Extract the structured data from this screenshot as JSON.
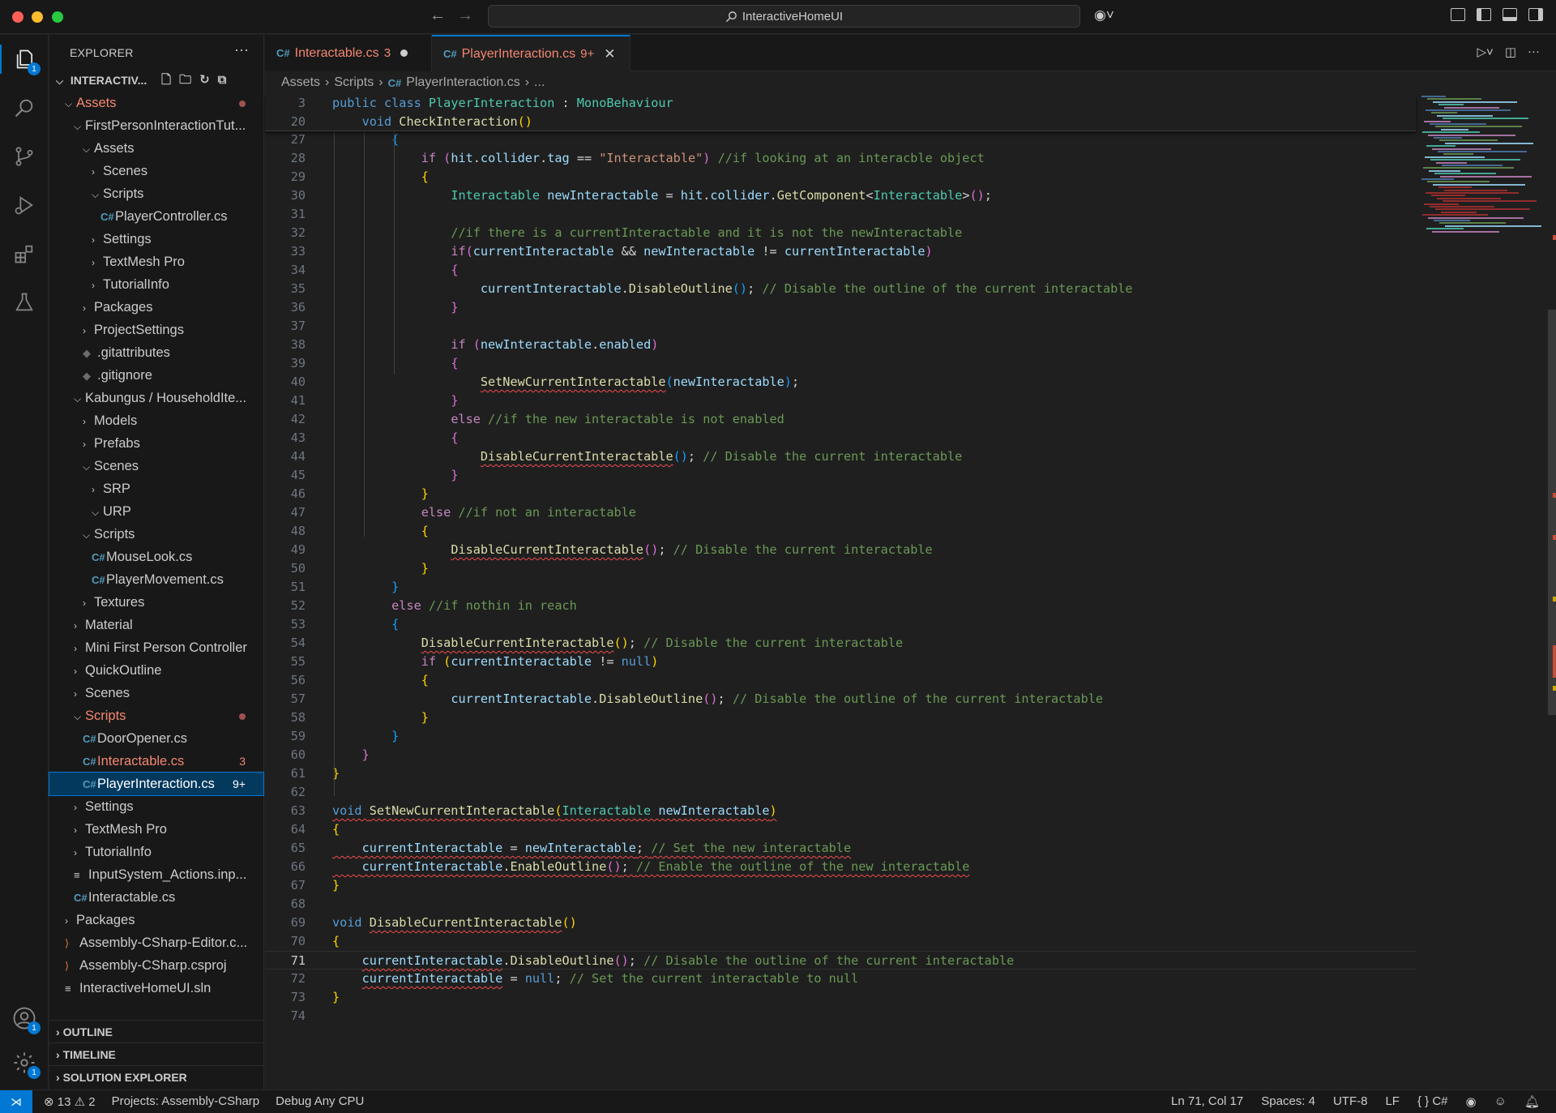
{
  "titlebar": {
    "search_text": "InteractiveHomeUI"
  },
  "activity": {
    "explorer_badge": "1",
    "accounts_badge": "1",
    "manage_badge": "1"
  },
  "explorer": {
    "title": "EXPLORER",
    "root": "INTERACTIV...",
    "tree": [
      {
        "label": "Assets",
        "indent": 1,
        "kind": "open",
        "err": true,
        "dot": true
      },
      {
        "label": "FirstPersonInteractionTut...",
        "indent": 2,
        "kind": "open"
      },
      {
        "label": "Assets",
        "indent": 3,
        "kind": "open"
      },
      {
        "label": "Scenes",
        "indent": 4,
        "kind": "closed"
      },
      {
        "label": "Scripts",
        "indent": 4,
        "kind": "open"
      },
      {
        "label": "PlayerController.cs",
        "indent": 5,
        "kind": "cs"
      },
      {
        "label": "Settings",
        "indent": 4,
        "kind": "closed"
      },
      {
        "label": "TextMesh Pro",
        "indent": 4,
        "kind": "closed"
      },
      {
        "label": "TutorialInfo",
        "indent": 4,
        "kind": "closed"
      },
      {
        "label": "Packages",
        "indent": 3,
        "kind": "closed"
      },
      {
        "label": "ProjectSettings",
        "indent": 3,
        "kind": "closed"
      },
      {
        "label": ".gitattributes",
        "indent": 3,
        "kind": "git"
      },
      {
        "label": ".gitignore",
        "indent": 3,
        "kind": "git"
      },
      {
        "label": "Kabungus / HouseholdIte...",
        "indent": 2,
        "kind": "open"
      },
      {
        "label": "Models",
        "indent": 3,
        "kind": "closed"
      },
      {
        "label": "Prefabs",
        "indent": 3,
        "kind": "closed"
      },
      {
        "label": "Scenes",
        "indent": 3,
        "kind": "open"
      },
      {
        "label": "SRP",
        "indent": 4,
        "kind": "closed"
      },
      {
        "label": "URP",
        "indent": 4,
        "kind": "open"
      },
      {
        "label": "Scripts",
        "indent": 3,
        "kind": "open"
      },
      {
        "label": "MouseLook.cs",
        "indent": 4,
        "kind": "cs"
      },
      {
        "label": "PlayerMovement.cs",
        "indent": 4,
        "kind": "cs"
      },
      {
        "label": "Textures",
        "indent": 3,
        "kind": "closed"
      },
      {
        "label": "Material",
        "indent": 2,
        "kind": "closed"
      },
      {
        "label": "Mini First Person Controller",
        "indent": 2,
        "kind": "closed"
      },
      {
        "label": "QuickOutline",
        "indent": 2,
        "kind": "closed"
      },
      {
        "label": "Scenes",
        "indent": 2,
        "kind": "closed"
      },
      {
        "label": "Scripts",
        "indent": 2,
        "kind": "open",
        "err": true,
        "dot": true
      },
      {
        "label": "DoorOpener.cs",
        "indent": 3,
        "kind": "cs"
      },
      {
        "label": "Interactable.cs",
        "indent": 3,
        "kind": "cs",
        "err": true,
        "count": "3"
      },
      {
        "label": "PlayerInteraction.cs",
        "indent": 3,
        "kind": "cs",
        "sel": true,
        "count": "9+"
      },
      {
        "label": "Settings",
        "indent": 2,
        "kind": "closed"
      },
      {
        "label": "TextMesh Pro",
        "indent": 2,
        "kind": "closed"
      },
      {
        "label": "TutorialInfo",
        "indent": 2,
        "kind": "closed"
      },
      {
        "label": "InputSystem_Actions.inp...",
        "indent": 2,
        "kind": "lines"
      },
      {
        "label": "Interactable.cs",
        "indent": 2,
        "kind": "cs"
      },
      {
        "label": "Packages",
        "indent": 1,
        "kind": "closed"
      },
      {
        "label": "Assembly-CSharp-Editor.c...",
        "indent": 1,
        "kind": "xml"
      },
      {
        "label": "Assembly-CSharp.csproj",
        "indent": 1,
        "kind": "xml"
      },
      {
        "label": "InteractiveHomeUI.sln",
        "indent": 1,
        "kind": "lines"
      }
    ],
    "sections": [
      "OUTLINE",
      "TIMELINE",
      "SOLUTION EXPLORER"
    ]
  },
  "tabs": [
    {
      "label": "Interactable.cs",
      "count": "3"
    },
    {
      "label": "PlayerInteraction.cs",
      "count": "9+"
    }
  ],
  "breadcrumb": [
    "Assets",
    "Scripts",
    "PlayerInteraction.cs",
    "..."
  ],
  "code": {
    "sticky": [
      {
        "n": "3",
        "t": [
          [
            "k",
            "public "
          ],
          [
            "k",
            "class "
          ],
          [
            "t",
            "PlayerInteraction"
          ],
          [
            "p",
            " : "
          ],
          [
            "t",
            "MonoBehaviour"
          ]
        ]
      },
      {
        "n": "20",
        "t": [
          [
            "p",
            "    "
          ],
          [
            "k",
            "void "
          ],
          [
            "f",
            "CheckInteraction"
          ],
          [
            "by",
            "()"
          ]
        ]
      }
    ],
    "lines": [
      {
        "n": "27",
        "t": [
          [
            "p",
            "        "
          ],
          [
            "bb",
            "{"
          ]
        ]
      },
      {
        "n": "28",
        "t": [
          [
            "p",
            "            "
          ],
          [
            "c",
            "if "
          ],
          [
            "bp",
            "("
          ],
          [
            "v",
            "hit"
          ],
          [
            "p",
            "."
          ],
          [
            "v",
            "collider"
          ],
          [
            "p",
            "."
          ],
          [
            "v",
            "tag"
          ],
          [
            "p",
            " == "
          ],
          [
            "s",
            "\"Interactable\""
          ],
          [
            "bp",
            ")"
          ],
          [
            "cm",
            " //if looking at an interacble object"
          ]
        ]
      },
      {
        "n": "29",
        "t": [
          [
            "p",
            "            "
          ],
          [
            "by",
            "{"
          ]
        ]
      },
      {
        "n": "30",
        "t": [
          [
            "p",
            "                "
          ],
          [
            "t",
            "Interactable "
          ],
          [
            "v",
            "newInteractable"
          ],
          [
            "p",
            " = "
          ],
          [
            "v",
            "hit"
          ],
          [
            "p",
            "."
          ],
          [
            "v",
            "collider"
          ],
          [
            "p",
            "."
          ],
          [
            "f",
            "GetComponent"
          ],
          [
            "p",
            "<"
          ],
          [
            "t",
            "Interactable"
          ],
          [
            "p",
            ">"
          ],
          [
            "bp",
            "()"
          ],
          [
            "p",
            ";"
          ]
        ]
      },
      {
        "n": "31",
        "t": []
      },
      {
        "n": "32",
        "t": [
          [
            "p",
            "                "
          ],
          [
            "cm",
            "//if there is a currentInteractable and it is not the newInteractable"
          ]
        ]
      },
      {
        "n": "33",
        "t": [
          [
            "p",
            "                "
          ],
          [
            "c",
            "if"
          ],
          [
            "bp",
            "("
          ],
          [
            "v",
            "currentInteractable"
          ],
          [
            "p",
            " && "
          ],
          [
            "v",
            "newInteractable"
          ],
          [
            "p",
            " != "
          ],
          [
            "v",
            "currentInteractable"
          ],
          [
            "bp",
            ")"
          ]
        ]
      },
      {
        "n": "34",
        "t": [
          [
            "p",
            "                "
          ],
          [
            "bp",
            "{"
          ]
        ]
      },
      {
        "n": "35",
        "t": [
          [
            "p",
            "                    "
          ],
          [
            "v",
            "currentInteractable"
          ],
          [
            "p",
            "."
          ],
          [
            "f",
            "DisableOutline"
          ],
          [
            "bb",
            "()"
          ],
          [
            "p",
            "; "
          ],
          [
            "cm",
            "// Disable the outline of the current interactable"
          ]
        ]
      },
      {
        "n": "36",
        "t": [
          [
            "p",
            "                "
          ],
          [
            "bp",
            "}"
          ]
        ]
      },
      {
        "n": "37",
        "t": []
      },
      {
        "n": "38",
        "t": [
          [
            "p",
            "                "
          ],
          [
            "c",
            "if "
          ],
          [
            "bp",
            "("
          ],
          [
            "v",
            "newInteractable"
          ],
          [
            "p",
            "."
          ],
          [
            "v",
            "enabled"
          ],
          [
            "bp",
            ")"
          ]
        ]
      },
      {
        "n": "39",
        "t": [
          [
            "p",
            "                "
          ],
          [
            "bp",
            "{"
          ]
        ]
      },
      {
        "n": "40",
        "t": [
          [
            "p",
            "                    "
          ],
          [
            "fsq",
            "SetNewCurrentInteractable"
          ],
          [
            "bb",
            "("
          ],
          [
            "v",
            "newInteractable"
          ],
          [
            "bb",
            ")"
          ],
          [
            "p",
            ";"
          ]
        ]
      },
      {
        "n": "41",
        "t": [
          [
            "p",
            "                "
          ],
          [
            "bp",
            "}"
          ]
        ]
      },
      {
        "n": "42",
        "t": [
          [
            "p",
            "                "
          ],
          [
            "c",
            "else "
          ],
          [
            "cm",
            "//if the new interactable is not enabled"
          ]
        ]
      },
      {
        "n": "43",
        "t": [
          [
            "p",
            "                "
          ],
          [
            "bp",
            "{"
          ]
        ]
      },
      {
        "n": "44",
        "t": [
          [
            "p",
            "                    "
          ],
          [
            "fsq",
            "DisableCurrentInteractable"
          ],
          [
            "bb",
            "()"
          ],
          [
            "p",
            "; "
          ],
          [
            "cm",
            "// Disable the current interactable"
          ]
        ]
      },
      {
        "n": "45",
        "t": [
          [
            "p",
            "                "
          ],
          [
            "bp",
            "}"
          ]
        ]
      },
      {
        "n": "46",
        "t": [
          [
            "p",
            "            "
          ],
          [
            "by",
            "}"
          ]
        ]
      },
      {
        "n": "47",
        "t": [
          [
            "p",
            "            "
          ],
          [
            "c",
            "else "
          ],
          [
            "cm",
            "//if not an interactable"
          ]
        ]
      },
      {
        "n": "48",
        "t": [
          [
            "p",
            "            "
          ],
          [
            "by",
            "{"
          ]
        ]
      },
      {
        "n": "49",
        "t": [
          [
            "p",
            "                "
          ],
          [
            "fsq",
            "DisableCurrentInteractable"
          ],
          [
            "bp",
            "()"
          ],
          [
            "p",
            "; "
          ],
          [
            "cm",
            "// Disable the current interactable"
          ]
        ]
      },
      {
        "n": "50",
        "t": [
          [
            "p",
            "            "
          ],
          [
            "by",
            "}"
          ]
        ]
      },
      {
        "n": "51",
        "t": [
          [
            "p",
            "        "
          ],
          [
            "bb",
            "}"
          ]
        ]
      },
      {
        "n": "52",
        "t": [
          [
            "p",
            "        "
          ],
          [
            "c",
            "else "
          ],
          [
            "cm",
            "//if nothin in reach"
          ]
        ]
      },
      {
        "n": "53",
        "t": [
          [
            "p",
            "        "
          ],
          [
            "bb",
            "{"
          ]
        ]
      },
      {
        "n": "54",
        "t": [
          [
            "p",
            "            "
          ],
          [
            "fsq",
            "DisableCurrentInteractable"
          ],
          [
            "by",
            "()"
          ],
          [
            "p",
            "; "
          ],
          [
            "cm",
            "// Disable the current interactable"
          ]
        ]
      },
      {
        "n": "55",
        "t": [
          [
            "p",
            "            "
          ],
          [
            "c",
            "if "
          ],
          [
            "by",
            "("
          ],
          [
            "v",
            "currentInteractable"
          ],
          [
            "p",
            " != "
          ],
          [
            "k",
            "null"
          ],
          [
            "by",
            ")"
          ]
        ]
      },
      {
        "n": "56",
        "t": [
          [
            "p",
            "            "
          ],
          [
            "by",
            "{"
          ]
        ]
      },
      {
        "n": "57",
        "t": [
          [
            "p",
            "                "
          ],
          [
            "v",
            "currentInteractable"
          ],
          [
            "p",
            "."
          ],
          [
            "f",
            "DisableOutline"
          ],
          [
            "bp",
            "()"
          ],
          [
            "p",
            "; "
          ],
          [
            "cm",
            "// Disable the outline of the current interactable"
          ]
        ]
      },
      {
        "n": "58",
        "t": [
          [
            "p",
            "            "
          ],
          [
            "by",
            "}"
          ]
        ]
      },
      {
        "n": "59",
        "t": [
          [
            "p",
            "        "
          ],
          [
            "bb",
            "}"
          ]
        ]
      },
      {
        "n": "60",
        "t": [
          [
            "p",
            "    "
          ],
          [
            "bp",
            "}"
          ]
        ]
      },
      {
        "n": "61",
        "t": [
          [
            "by",
            "}"
          ]
        ]
      },
      {
        "n": "62",
        "t": []
      },
      {
        "n": "63",
        "t": [
          [
            "ksq",
            "void "
          ],
          [
            "fsq",
            "SetNewCurrentInteractable"
          ],
          [
            "bysq",
            "("
          ],
          [
            "tsq",
            "Interactable "
          ],
          [
            "vsq",
            "newInteractable"
          ],
          [
            "bysq",
            ")"
          ]
        ]
      },
      {
        "n": "64",
        "t": [
          [
            "by",
            "{"
          ]
        ]
      },
      {
        "n": "65",
        "t": [
          [
            "psq",
            "    "
          ],
          [
            "vsq",
            "currentInteractable"
          ],
          [
            "psq",
            " = "
          ],
          [
            "vsq",
            "newInteractable"
          ],
          [
            "psq",
            "; "
          ],
          [
            "cmsq",
            "// Set the new interactable"
          ]
        ]
      },
      {
        "n": "66",
        "t": [
          [
            "psq",
            "    "
          ],
          [
            "vsq",
            "currentInteractable"
          ],
          [
            "psq",
            "."
          ],
          [
            "fsq",
            "EnableOutline"
          ],
          [
            "bpsq",
            "()"
          ],
          [
            "psq",
            "; "
          ],
          [
            "cmsq",
            "// Enable the outline of the new interactable"
          ]
        ]
      },
      {
        "n": "67",
        "t": [
          [
            "by",
            "}"
          ]
        ]
      },
      {
        "n": "68",
        "t": []
      },
      {
        "n": "69",
        "t": [
          [
            "k",
            "void "
          ],
          [
            "fsq",
            "DisableCurrentInteractable"
          ],
          [
            "by",
            "()"
          ]
        ]
      },
      {
        "n": "70",
        "t": [
          [
            "by",
            "{"
          ]
        ]
      },
      {
        "n": "71",
        "t": [
          [
            "p",
            "    "
          ],
          [
            "vsq",
            "currentInteractable"
          ],
          [
            "p",
            "."
          ],
          [
            "f",
            "DisableOutline"
          ],
          [
            "bp",
            "()"
          ],
          [
            "p",
            "; "
          ],
          [
            "cm",
            "// Disable the outline of the current interactable"
          ]
        ],
        "cur": true
      },
      {
        "n": "72",
        "t": [
          [
            "p",
            "    "
          ],
          [
            "vsq",
            "currentInteractable"
          ],
          [
            "p",
            " = "
          ],
          [
            "k",
            "null"
          ],
          [
            "p",
            "; "
          ],
          [
            "cm",
            "// Set the current interactable to null"
          ]
        ]
      },
      {
        "n": "73",
        "t": [
          [
            "by",
            "}"
          ]
        ]
      },
      {
        "n": "74",
        "t": []
      }
    ]
  },
  "statusbar": {
    "errors": "13",
    "warnings": "2",
    "projects": "Projects: Assembly-CSharp",
    "config": "Debug Any CPU",
    "position": "Ln 71, Col 17",
    "spaces": "Spaces: 4",
    "encoding": "UTF-8",
    "eol": "LF",
    "language": "C#"
  }
}
